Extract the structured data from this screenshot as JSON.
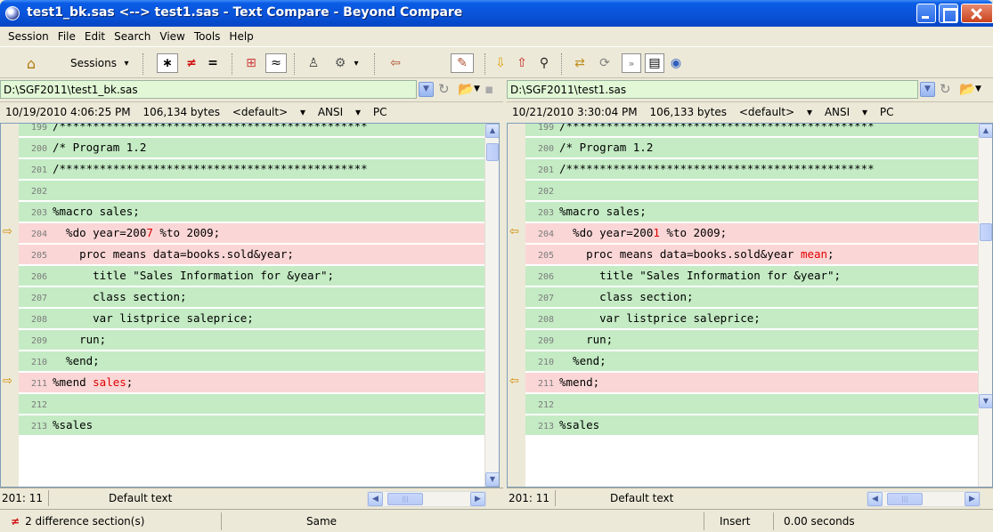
{
  "window": {
    "title": "test1_bk.sas <--> test1.sas - Text Compare - Beyond Compare",
    "icons": [
      "app-icon",
      "minimize-icon",
      "maximize-icon",
      "close-icon"
    ]
  },
  "menu": [
    "Session",
    "File",
    "Edit",
    "Search",
    "View",
    "Tools",
    "Help"
  ],
  "toolbar": {
    "sessions_label": "Sessions",
    "sessions_caret": "▾",
    "all_glyph": "∗",
    "diffs_glyph": "≠",
    "same_glyph": "=",
    "context_glyph": "⊞",
    "minor_glyph": "≈",
    "rules_glyph": "♙",
    "format_glyph": "⚙",
    "format_caret": "▾",
    "copy_left_glyph": "⇦",
    "edit_glyph": "✎",
    "next_glyph": "⇩",
    "prev_glyph": "⇧",
    "find_glyph": "⚲",
    "swap_glyph": "⇄",
    "refresh_glyph": "⟳",
    "expand_glyph": "»",
    "layout_glyph": "▤",
    "web_glyph": "◉"
  },
  "left": {
    "path": "D:\\SGF2011\\test1_bk.sas",
    "timestamp": "10/19/2010 4:06:25 PM",
    "size": "106,134 bytes",
    "format": "<default>",
    "encoding": "ANSI",
    "line_end": "PC",
    "cursor": "201: 11",
    "mode": "Default text",
    "lines": [
      {
        "num": "199",
        "text": "/**********************************************",
        "type": "same"
      },
      {
        "num": "200",
        "text": "/* Program 1.2",
        "type": "same"
      },
      {
        "num": "201",
        "text": "/**********************************************",
        "type": "same"
      },
      {
        "num": "202",
        "text": "",
        "type": "same"
      },
      {
        "num": "203",
        "text": "%macro sales;",
        "type": "same"
      },
      {
        "num": "204",
        "pre": "  %do year=200",
        "hl": "7",
        "post": " %to 2009;",
        "type": "diff",
        "marker": "⇨"
      },
      {
        "num": "205",
        "text": "    proc means data=books.sold&year;",
        "type": "diff"
      },
      {
        "num": "206",
        "text": "      title \"Sales Information for &year\";",
        "type": "same"
      },
      {
        "num": "207",
        "text": "      class section;",
        "type": "same"
      },
      {
        "num": "208",
        "text": "      var listprice saleprice;",
        "type": "same"
      },
      {
        "num": "209",
        "text": "    run;",
        "type": "same"
      },
      {
        "num": "210",
        "text": "  %end;",
        "type": "same"
      },
      {
        "num": "211",
        "pre": "%mend ",
        "hl": "sales",
        "post": ";",
        "type": "diff",
        "marker": "⇨"
      },
      {
        "num": "212",
        "text": "",
        "type": "same"
      },
      {
        "num": "213",
        "text": "%sales",
        "type": "same"
      }
    ]
  },
  "right": {
    "path": "D:\\SGF2011\\test1.sas",
    "timestamp": "10/21/2010 3:30:04 PM",
    "size": "106,133 bytes",
    "format": "<default>",
    "encoding": "ANSI",
    "line_end": "PC",
    "cursor": "201: 11",
    "mode": "Default text",
    "lines": [
      {
        "num": "199",
        "text": "/**********************************************",
        "type": "same"
      },
      {
        "num": "200",
        "text": "/* Program 1.2",
        "type": "same"
      },
      {
        "num": "201",
        "text": "/**********************************************",
        "type": "same"
      },
      {
        "num": "202",
        "text": "",
        "type": "same"
      },
      {
        "num": "203",
        "text": "%macro sales;",
        "type": "same"
      },
      {
        "num": "204",
        "pre": "  %do year=200",
        "hl": "1",
        "post": " %to 2009;",
        "type": "diff",
        "marker": "⇦"
      },
      {
        "num": "205",
        "pre": "    proc means data=books.sold&year ",
        "hl": "mean",
        "post": ";",
        "type": "diff"
      },
      {
        "num": "206",
        "text": "      title \"Sales Information for &year\";",
        "type": "same"
      },
      {
        "num": "207",
        "text": "      class section;",
        "type": "same"
      },
      {
        "num": "208",
        "text": "      var listprice saleprice;",
        "type": "same"
      },
      {
        "num": "209",
        "text": "    run;",
        "type": "same"
      },
      {
        "num": "210",
        "text": "  %end;",
        "type": "same"
      },
      {
        "num": "211",
        "text": "%mend;",
        "type": "diff",
        "marker": "⇦"
      },
      {
        "num": "212",
        "text": "",
        "type": "same"
      },
      {
        "num": "213",
        "text": "%sales",
        "type": "same"
      }
    ]
  },
  "status": {
    "diff_glyph": "≠",
    "differences": "2 difference section(s)",
    "compare_state": "Same",
    "insert_mode": "Insert",
    "elapsed": "0.00 seconds"
  },
  "colors": {
    "same_bg": "#c4ebc4",
    "diff_bg": "#fbd6d6",
    "highlight": "#e00000",
    "titlebar": "#0a52d8"
  }
}
